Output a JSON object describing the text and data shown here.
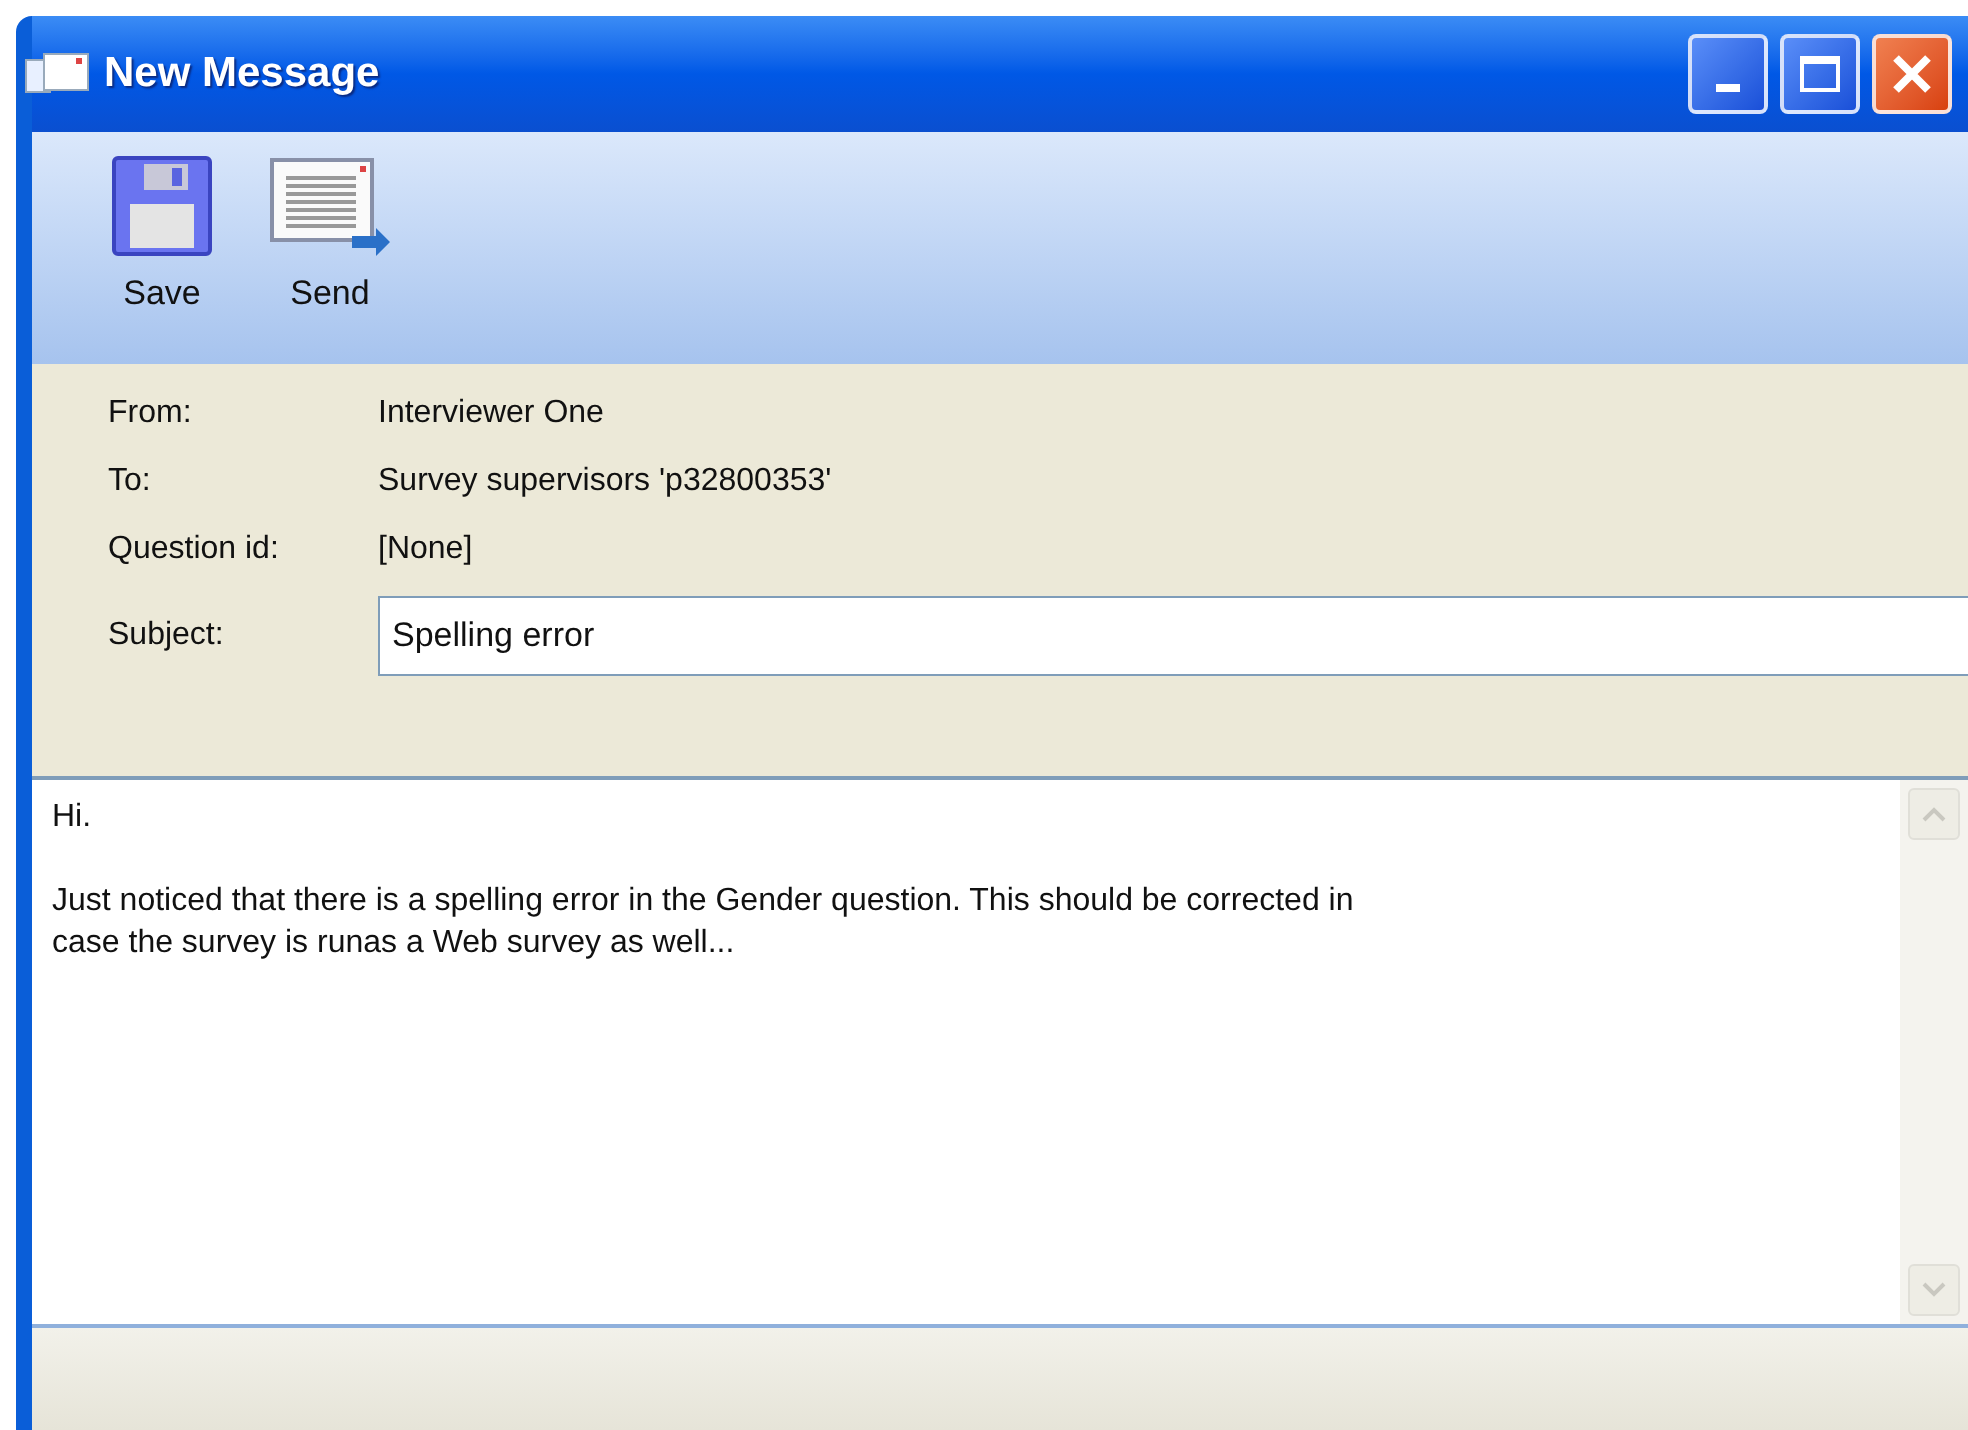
{
  "window": {
    "title": "New Message"
  },
  "toolbar": [
    {
      "kind": "save",
      "label": "Save"
    },
    {
      "kind": "send",
      "label": "Send"
    }
  ],
  "header_fields": [
    {
      "label": "From:",
      "value": "Interviewer One"
    },
    {
      "label": "To:",
      "value": "Survey supervisors 'p32800353'"
    },
    {
      "label": "Question id:",
      "value": "[None]"
    }
  ],
  "subject": {
    "label": "Subject:",
    "value": "Spelling error"
  },
  "body": {
    "value": "Hi.\n\nJust noticed that there is a spelling error in the Gender question. This should be corrected in\ncase the survey is runas a Web survey as well..."
  }
}
